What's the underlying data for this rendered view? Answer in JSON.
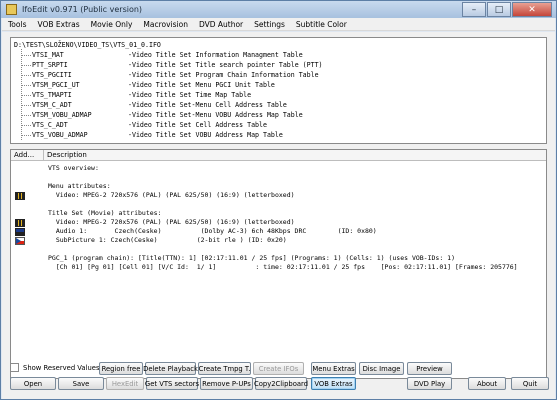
{
  "window": {
    "title": "IfoEdit v0.971 (Public version)",
    "minimize": "–",
    "maximize": "□",
    "close": "✕"
  },
  "menu": [
    "Tools",
    "VOB Extras",
    "Movie Only",
    "Macrovision",
    "DVD Author",
    "Settings",
    "Subtitle Color"
  ],
  "tree": {
    "root": "D:\\TEST\\SLOŽENO\\VIDEO_TS\\VTS_01_0.IFO",
    "items": [
      {
        "name": "VTSI_MAT",
        "desc": "-Video Title Set Information Managment Table"
      },
      {
        "name": "PTT_SRPTI",
        "desc": "-Video Title Set Title search pointer Table (PTT)"
      },
      {
        "name": "VTS_PGCITI",
        "desc": "-Video Title Set Program Chain Information Table"
      },
      {
        "name": "VTSM_PGCI_UT",
        "desc": "-Video Title Set Menu PGCI Unit Table"
      },
      {
        "name": "VTS_TMAPTI",
        "desc": "-Video Title Set Time Map Table"
      },
      {
        "name": "VTSM_C_ADT",
        "desc": "-Video Title Set-Menu Cell Address Table"
      },
      {
        "name": "VTSM_VOBU_ADMAP",
        "desc": "-Video Title Set-Menu VOBU Address Map Table"
      },
      {
        "name": "VTS_C_ADT",
        "desc": "-Video Title Set Cell Address Table"
      },
      {
        "name": "VTS_VOBU_ADMAP",
        "desc": "-Video Title Set VOBU Address Map Table"
      }
    ]
  },
  "grid": {
    "col_add": "Add...",
    "col_desc": "Description",
    "lines": [
      "VTS overview:",
      "",
      "Menu attributes:",
      "  Video: MPEG-2 720x576 (PAL) (PAL 625/50) (16:9) (letterboxed)",
      "",
      "Title Set (Movie) attributes:",
      "  Video: MPEG-2 720x576 (PAL) (PAL 625/50) (16:9) (letterboxed)",
      "  Audio 1:       Czech(Ceske)          (Dolby AC-3) 6ch 48Kbps DRC        (ID: 0x80)",
      "  SubPicture 1: Czech(Ceske)          (2-bit rle ) (ID: 0x20)",
      "",
      "PGC_1 (program chain): [Title(TTN): 1] [02:17:11.01 / 25 fps] (Programs: 1) (Cells: 1) (uses VOB-IDs: 1)",
      "  [Ch 01] [Pg 01] [Cell 01] [V/C Id:  1/ 1]          : time: 02:17:11.01 / 25 fps    [Pos: 02:17:11.01] [Frames: 205776]"
    ]
  },
  "buttons_row1": {
    "show_reserved": "Show Reserved Values",
    "region_free": "Region free",
    "delete_playback": "Delete Playback",
    "create_tmpg": "Create Tmpg T.",
    "create_ifos": "Create IFOs",
    "menu_extras": "Menu Extras",
    "disc_image": "Disc Image",
    "preview": "Preview"
  },
  "buttons_row2": {
    "open": "Open",
    "save": "Save",
    "hexedit": "HexEdit",
    "get_vts": "Get VTS sectors",
    "remove_pups": "Remove P-UPs",
    "copy2clip": "Copy2Clipboard",
    "vob_extras": "VOB Extras",
    "dvd_play": "DVD Play",
    "about": "About",
    "quit": "Quit"
  },
  "icons": {
    "video": "video-film-icon",
    "audio": "audio-icon",
    "subtitle": "czech-flag-icon"
  }
}
